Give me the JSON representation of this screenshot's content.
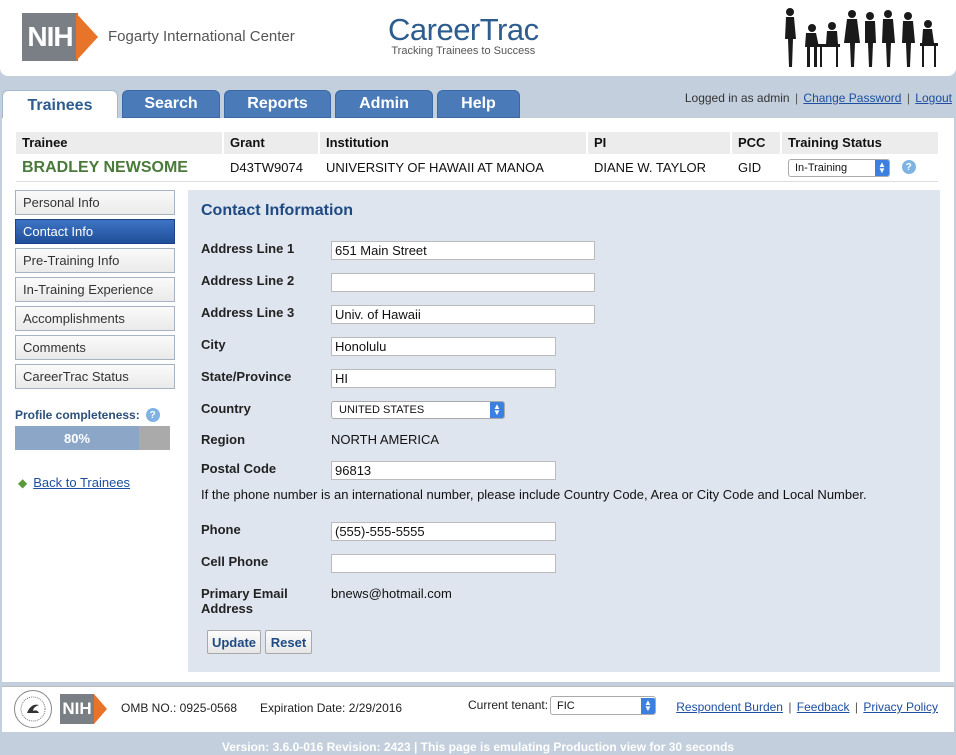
{
  "header": {
    "nih_logo_text": "NIH",
    "center_name": "Fogarty International Center",
    "app_title": "CareerTrac",
    "app_subtitle": "Tracking Trainees to Success"
  },
  "tabs": [
    {
      "label": "Trainees",
      "active": true
    },
    {
      "label": "Search"
    },
    {
      "label": "Reports"
    },
    {
      "label": "Admin"
    },
    {
      "label": "Help"
    }
  ],
  "login": {
    "status": "Logged in as admin",
    "change_password": "Change Password",
    "logout": "Logout"
  },
  "trainee": {
    "headers": [
      "Trainee",
      "Grant",
      "Institution",
      "PI",
      "PCC",
      "Training Status"
    ],
    "name": "BRADLEY NEWSOME",
    "grant": "D43TW9074",
    "institution": "UNIVERSITY OF HAWAII AT MANOA",
    "pi": "DIANE W. TAYLOR",
    "pcc": "GID",
    "training_status": "In-Training"
  },
  "nav": [
    {
      "label": "Personal Info"
    },
    {
      "label": "Contact Info",
      "active": true
    },
    {
      "label": "Pre-Training Info"
    },
    {
      "label": "In-Training Experience"
    },
    {
      "label": "Accomplishments"
    },
    {
      "label": "Comments"
    },
    {
      "label": "CareerTrac Status"
    }
  ],
  "profile": {
    "label": "Profile completeness:",
    "percent": 80,
    "percent_label": "80%"
  },
  "back_link": "Back to Trainees",
  "form": {
    "title": "Contact Information",
    "address1_label": "Address Line 1",
    "address1": "651 Main Street",
    "address2_label": "Address Line 2",
    "address2": "",
    "address3_label": "Address Line 3",
    "address3": "Univ. of Hawaii",
    "city_label": "City",
    "city": "Honolulu",
    "state_label": "State/Province",
    "state": "HI",
    "country_label": "Country",
    "country": "UNITED STATES",
    "region_label": "Region",
    "region": "NORTH AMERICA",
    "postal_label": "Postal Code",
    "postal": "96813",
    "phone_note": "If the phone number is an international number, please include Country Code, Area or City Code and Local Number.",
    "phone_label": "Phone",
    "phone": "(555)-555-5555",
    "cell_label": "Cell Phone",
    "cell": "",
    "email_label_1": "Primary Email",
    "email_label_2": "Address",
    "email": "bnews@hotmail.com",
    "update_button": "Update",
    "reset_button": "Reset"
  },
  "footer": {
    "nih_text": "NIH",
    "omb": "OMB NO.: 0925-0568",
    "expiration": "Expiration Date: 2/29/2016",
    "tenant_label": "Current tenant:",
    "tenant": "FIC",
    "links": [
      "Respondent Burden",
      "Feedback",
      "Privacy Policy"
    ]
  },
  "version": "Version: 3.6.0-016 Revision: 2423 | This page is emulating Production view for 30 seconds",
  "colors": {
    "brand_blue": "#2d5c8e",
    "tab_blue": "#4a7ab8",
    "nih_orange": "#e8742a",
    "trainee_green": "#4a7a3a",
    "form_bg": "#dfe5ee"
  }
}
